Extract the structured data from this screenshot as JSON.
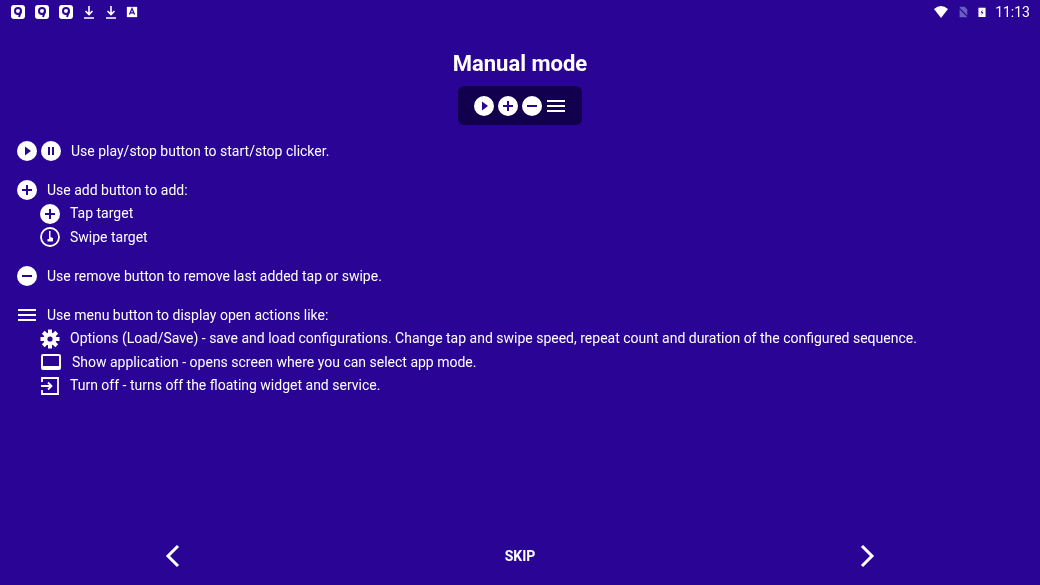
{
  "status_bar": {
    "time": "11:13"
  },
  "title": "Manual mode",
  "widget": {
    "buttons": [
      {
        "kind": "play"
      },
      {
        "kind": "add"
      },
      {
        "kind": "remove"
      },
      {
        "kind": "menu"
      }
    ]
  },
  "sections": [
    {
      "icons": [
        {
          "kind": "play"
        },
        {
          "kind": "pause"
        }
      ],
      "text": "Use play/stop button to start/stop clicker."
    },
    {
      "icons": [
        {
          "kind": "add"
        }
      ],
      "text": "Use add button to add:",
      "items": [
        {
          "kind": "add",
          "text": "Tap target"
        },
        {
          "kind": "swipe",
          "text": "Swipe target"
        }
      ]
    },
    {
      "icons": [
        {
          "kind": "remove"
        }
      ],
      "text": "Use remove button to remove last added tap or swipe."
    },
    {
      "icons": [
        {
          "kind": "menu"
        }
      ],
      "text": "Use menu button to display open actions like:",
      "items": [
        {
          "kind": "gear",
          "text": "Options (Load/Save) - save and load configurations. Change tap and swipe speed, repeat count and duration of the configured sequence."
        },
        {
          "kind": "window",
          "text": "Show application - opens screen where you can select app mode."
        },
        {
          "kind": "exit",
          "text": "Turn off - turns off the floating widget and service."
        }
      ]
    }
  ],
  "nav": {
    "skip": "SKIP"
  }
}
